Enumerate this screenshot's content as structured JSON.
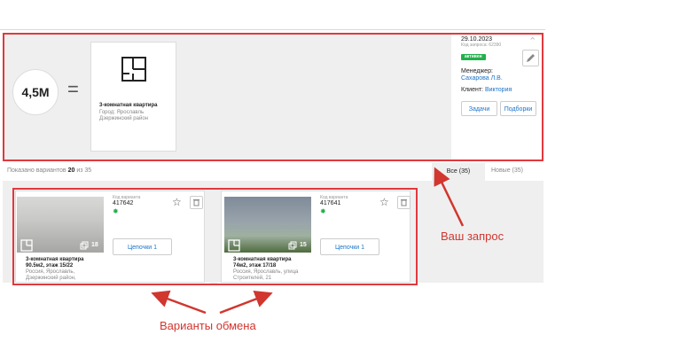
{
  "request": {
    "price": "4,5М",
    "equals": "=",
    "object": {
      "title": "3-комнатная квартира",
      "city": "Город: Ярославль",
      "district": "Дзержинский район"
    },
    "date": "29.10.2023",
    "request_code": "Код запроса: 62390",
    "status": "активен",
    "manager_label": "Менеджер:",
    "manager_name": "Сахарова Л.В.",
    "client_label": "Клиент: ",
    "client_name": "Виктория",
    "tasks_button": "Задачи",
    "selections_button": "Подборки"
  },
  "variants_header": {
    "shown_label": "Показано вариантов",
    "shown_count": "20",
    "of_label": "из",
    "total": "35",
    "tab_all": "Все (35)",
    "tab_new": "Новые (35)"
  },
  "variants": [
    {
      "photo_count": "18",
      "title_line1": "3-комнатная квартира",
      "title_line2": "90.5м2, этаж 15/22",
      "address_line1": "Россия, Ярославль,",
      "address_line2": "Дзержинский район,",
      "code_label": "Код варианта",
      "code": "417642",
      "chain_button": "Цепочки 1"
    },
    {
      "photo_count": "15",
      "title_line1": "3-комнатная квартира",
      "title_line2": "74м2, этаж 17/18",
      "address_line1": "Россия, Ярославль, улица",
      "address_line2": "Строителей, 21",
      "code_label": "Код варианта",
      "code": "417641",
      "chain_button": "Цепочки 1"
    }
  ],
  "annotations": {
    "your_request": "Ваш запрос",
    "exchange_variants": "Варианты обмена"
  },
  "colors": {
    "accent_red": "#e0393e",
    "link_blue": "#1a73c8",
    "status_green": "#21b04b"
  }
}
